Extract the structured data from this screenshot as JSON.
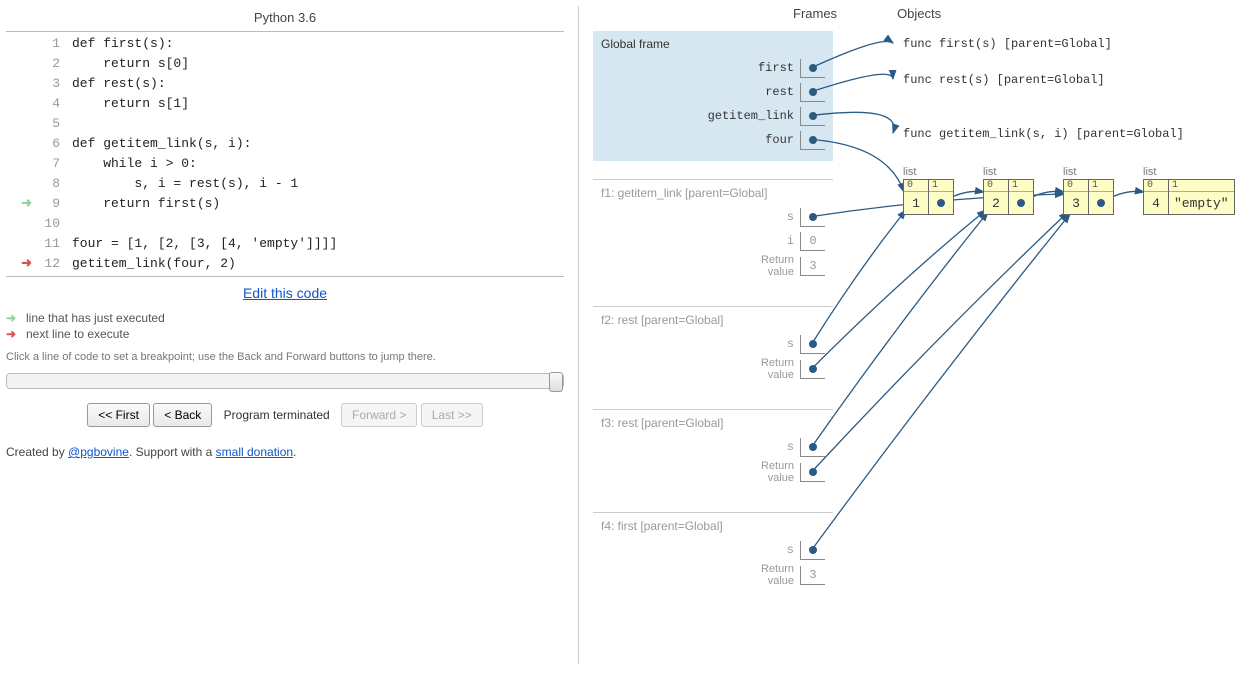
{
  "language_title": "Python 3.6",
  "code_lines": [
    {
      "n": 1,
      "text": "def first(s):"
    },
    {
      "n": 2,
      "text": "    return s[0]"
    },
    {
      "n": 3,
      "text": "def rest(s):"
    },
    {
      "n": 4,
      "text": "    return s[1]"
    },
    {
      "n": 5,
      "text": ""
    },
    {
      "n": 6,
      "text": "def getitem_link(s, i):"
    },
    {
      "n": 7,
      "text": "    while i > 0:"
    },
    {
      "n": 8,
      "text": "        s, i = rest(s), i - 1"
    },
    {
      "n": 9,
      "text": "    return first(s)"
    },
    {
      "n": 10,
      "text": ""
    },
    {
      "n": 11,
      "text": "four = [1, [2, [3, [4, 'empty']]]]"
    },
    {
      "n": 12,
      "text": "getitem_link(four, 2)"
    }
  ],
  "just_executed_line": 9,
  "next_line": 12,
  "edit_link_label": "Edit this code",
  "legend": {
    "just_executed": "line that has just executed",
    "next_line": "next line to execute"
  },
  "breakpoint_hint": "Click a line of code to set a breakpoint; use the Back and Forward buttons to jump there.",
  "controls": {
    "first": "<< First",
    "back": "< Back",
    "status": "Program terminated",
    "forward": "Forward >",
    "last": "Last >>"
  },
  "credit": {
    "prefix": "Created by ",
    "author": "@pgbovine",
    "middle": ". Support with a ",
    "donation": "small donation",
    "suffix": "."
  },
  "headers": {
    "frames": "Frames",
    "objects": "Objects"
  },
  "global_frame": {
    "title": "Global frame",
    "vars": [
      "first",
      "rest",
      "getitem_link",
      "four"
    ]
  },
  "call_frames": [
    {
      "title": "f1: getitem_link [parent=Global]",
      "rows": [
        {
          "name": "s",
          "value": null,
          "ptr": true
        },
        {
          "name": "i",
          "value": "0"
        },
        {
          "name_html": "Return<br>value",
          "value": "3"
        }
      ]
    },
    {
      "title": "f2: rest [parent=Global]",
      "rows": [
        {
          "name": "s",
          "value": null,
          "ptr": true
        },
        {
          "name_html": "Return<br>value",
          "value": null,
          "ptr": true
        }
      ]
    },
    {
      "title": "f3: rest [parent=Global]",
      "rows": [
        {
          "name": "s",
          "value": null,
          "ptr": true
        },
        {
          "name_html": "Return<br>value",
          "value": null,
          "ptr": true
        }
      ]
    },
    {
      "title": "f4: first [parent=Global]",
      "rows": [
        {
          "name": "s",
          "value": null,
          "ptr": true
        },
        {
          "name_html": "Return<br>value",
          "value": "3"
        }
      ]
    }
  ],
  "func_objects": [
    "func first(s) [parent=Global]",
    "func rest(s) [parent=Global]",
    "func getitem_link(s, i) [parent=Global]"
  ],
  "list_objects": [
    {
      "caption": "list",
      "cells": [
        {
          "idx": "0",
          "val": "1"
        },
        {
          "idx": "1",
          "ptr": true
        }
      ]
    },
    {
      "caption": "list",
      "cells": [
        {
          "idx": "0",
          "val": "2"
        },
        {
          "idx": "1",
          "ptr": true
        }
      ]
    },
    {
      "caption": "list",
      "cells": [
        {
          "idx": "0",
          "val": "3"
        },
        {
          "idx": "1",
          "ptr": true
        }
      ]
    },
    {
      "caption": "list",
      "cells": [
        {
          "idx": "0",
          "val": "4"
        },
        {
          "idx": "1",
          "val": "\"empty\""
        }
      ]
    }
  ],
  "colors": {
    "arrow": "#2b5b84",
    "list_bg": "#fffdc6",
    "global_bg": "#d7e7f2"
  }
}
